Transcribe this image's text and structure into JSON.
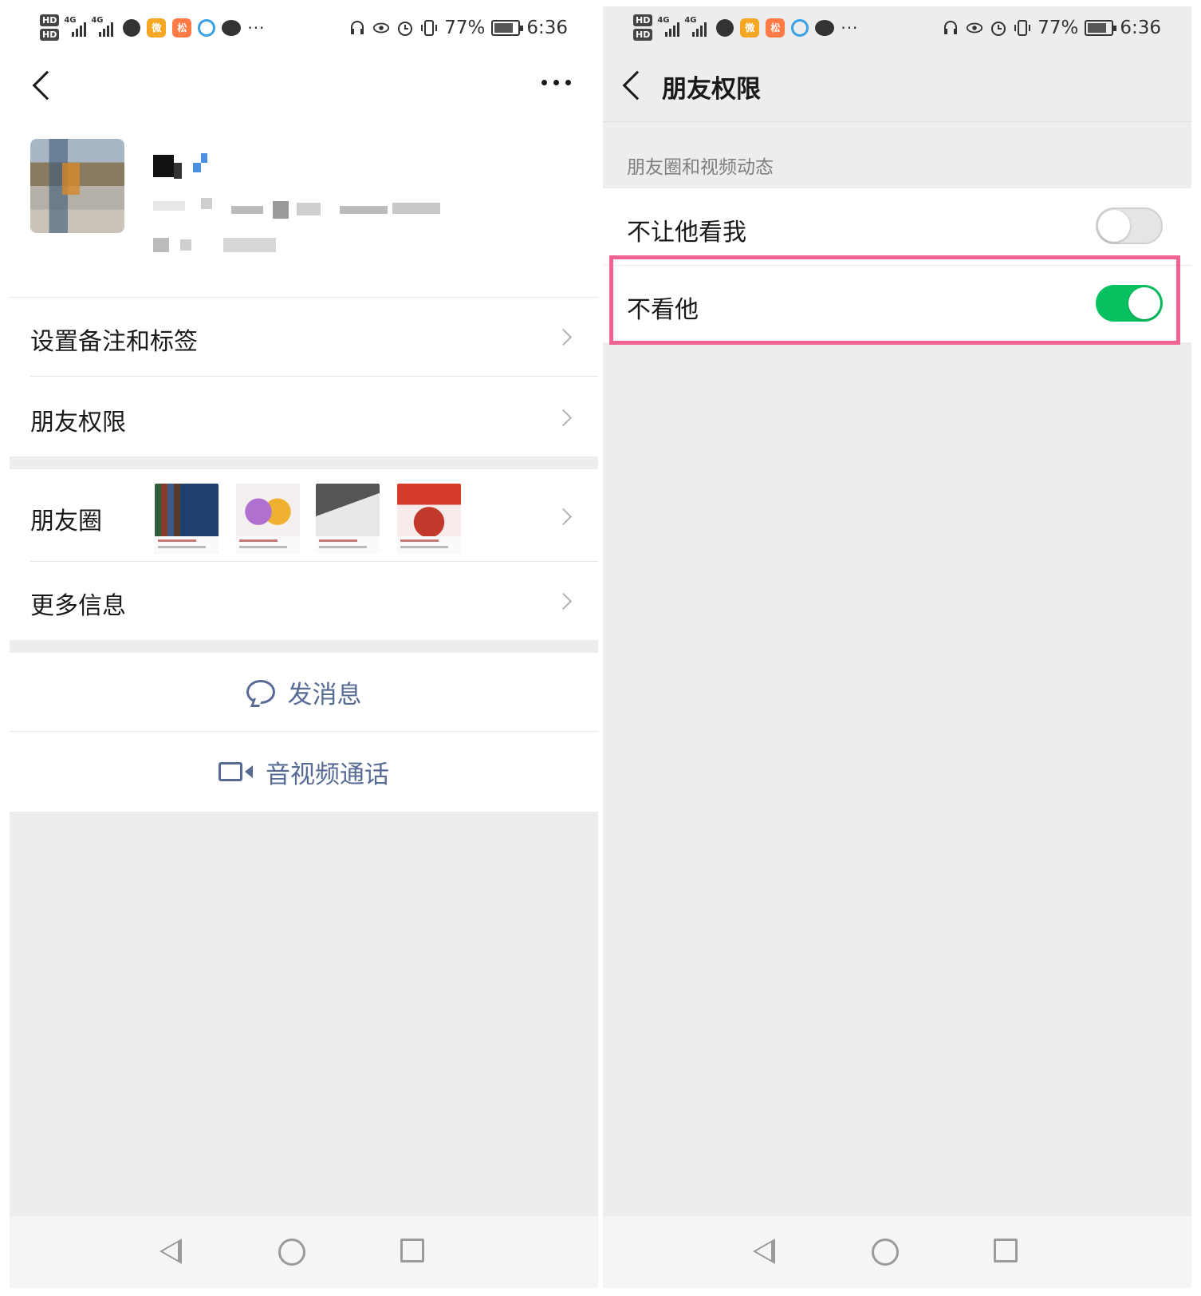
{
  "status_bar": {
    "battery_percent": "77%",
    "time": "6:36",
    "network": "4G",
    "hd_label": "HD"
  },
  "profile_page": {
    "menu_items": [
      {
        "label": "设置备注和标签"
      },
      {
        "label": "朋友权限"
      },
      {
        "label": "朋友圈"
      },
      {
        "label": "更多信息"
      }
    ],
    "moments_thumbnails": [
      {
        "icon": "book-product-thumbnail"
      },
      {
        "icon": "jacket-product-thumbnail"
      },
      {
        "icon": "lamp-product-thumbnail"
      },
      {
        "icon": "snack-product-thumbnail"
      }
    ],
    "actions": {
      "send_message": "发消息",
      "av_call": "音视频通话"
    }
  },
  "permissions_page": {
    "title": "朋友权限",
    "section_label": "朋友圈和视频动态",
    "options": [
      {
        "label": "不让他看我",
        "enabled": false
      },
      {
        "label": "不看他",
        "enabled": true
      }
    ]
  },
  "colors": {
    "toggle_on": "#07c160",
    "link_blue": "#576b95",
    "highlight": "#f06292",
    "background_gray": "#ededed"
  }
}
